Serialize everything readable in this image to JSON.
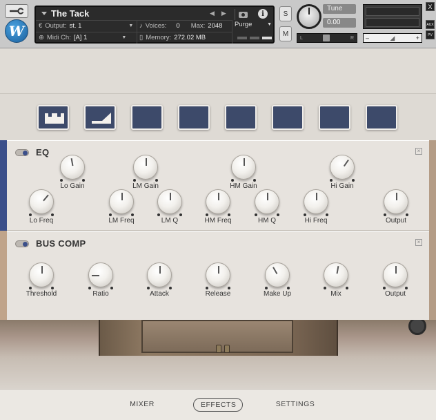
{
  "header": {
    "instrument_name": "The Tack",
    "output_label": "Output:",
    "output_value": "st. 1",
    "voices_label": "Voices:",
    "voices_value": "0",
    "max_label": "Max:",
    "max_value": "2048",
    "purge_label": "Purge",
    "midi_label": "Midi Ch:",
    "midi_value": "[A]  1",
    "memory_label": "Memory:",
    "memory_value": "272.02 MB",
    "solo_label": "S",
    "mute_label": "M",
    "tune_label": "Tune",
    "tune_value": "0.00",
    "pan_left": "L",
    "pan_right": "R",
    "vol_minus": "–",
    "vol_plus": "+",
    "aux_label": "AUX",
    "pv_label": "PV",
    "close_label": "X"
  },
  "eq": {
    "title": "EQ",
    "knobs": [
      {
        "label": "Lo Gain"
      },
      {
        "label": "LM Gain"
      },
      {
        "label": "HM Gain"
      },
      {
        "label": "Hi Gain"
      },
      {
        "label": "Lo Freq"
      },
      {
        "label": "LM Freq"
      },
      {
        "label": "LM Q"
      },
      {
        "label": "HM Freq"
      },
      {
        "label": "HM Q"
      },
      {
        "label": "Hi Freq"
      },
      {
        "label": "Output"
      }
    ]
  },
  "bus_comp": {
    "title": "BUS COMP",
    "knobs": [
      {
        "label": "Threshold"
      },
      {
        "label": "Ratio"
      },
      {
        "label": "Attack"
      },
      {
        "label": "Release"
      },
      {
        "label": "Make Up"
      },
      {
        "label": "Mix"
      },
      {
        "label": "Output"
      }
    ]
  },
  "nav": {
    "mixer": "MIXER",
    "effects": "EFFECTS",
    "settings": "SETTINGS",
    "active": "EFFECTS"
  },
  "colors": {
    "tile_blue": "#3d4a6a",
    "accent_blue": "#3b4f8a"
  }
}
